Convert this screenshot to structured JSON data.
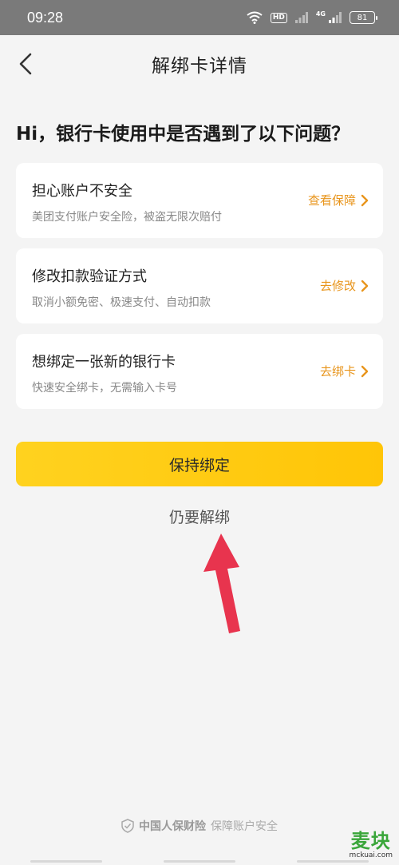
{
  "status_bar": {
    "time": "09:28",
    "hd_label": "HD",
    "network_label": "4G",
    "battery_level": "81"
  },
  "nav": {
    "title": "解绑卡详情"
  },
  "headline": "Hi，银行卡使用中是否遇到了以下问题？",
  "options": [
    {
      "title": "担心账户不安全",
      "desc": "美团支付账户安全险，被盗无限次赔付",
      "action": "查看保障"
    },
    {
      "title": "修改扣款验证方式",
      "desc": "取消小额免密、极速支付、自动扣款",
      "action": "去修改"
    },
    {
      "title": "想绑定一张新的银行卡",
      "desc": "快速安全绑卡，无需输入卡号",
      "action": "去绑卡"
    }
  ],
  "buttons": {
    "keep": "保持绑定",
    "unbind": "仍要解绑"
  },
  "footer": {
    "insurer": "中国人保财险",
    "text": "保障账户安全"
  },
  "watermark": {
    "main": "麦块",
    "sub": "mckuai.com"
  },
  "colors": {
    "accent_orange": "#e8951c",
    "button_yellow": "#ffc507",
    "arrow_red": "#e8344e",
    "status_bar_gray": "#7a7a7a"
  }
}
